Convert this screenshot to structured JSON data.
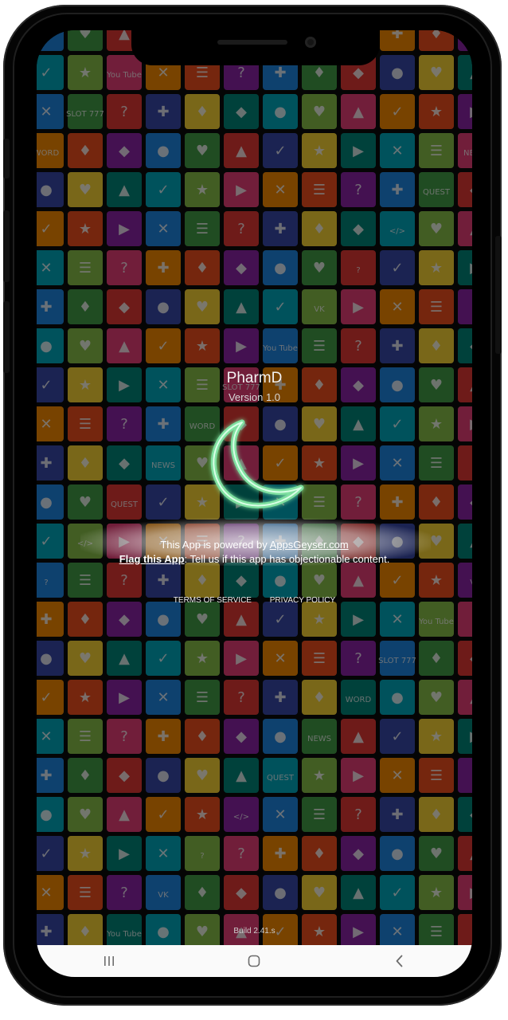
{
  "app": {
    "title": "PharmD",
    "version": "Version 1.0"
  },
  "powered": {
    "prefix": "This App is powered by ",
    "link": "AppsGeyser.com"
  },
  "flag": {
    "label": "Flag this App",
    "text": ": Tell us if this app has objectionable content."
  },
  "links": {
    "terms": "TERMS OF SERVICE",
    "privacy": "PRIVACY POLICY"
  },
  "build": "Build 2.41.s",
  "navbar": {
    "recents_icon": "recents-icon",
    "home_icon": "home-icon",
    "back_icon": "back-icon"
  },
  "colors": {
    "moon_glow": "#7fe0a0",
    "overlay": "#000000",
    "navbar": "#fafafa"
  },
  "tile_labels": [
    "VK",
    "You Tube",
    "SLOT 777",
    "WORD",
    "NEWS",
    "QUEST",
    "</>",
    "?"
  ]
}
